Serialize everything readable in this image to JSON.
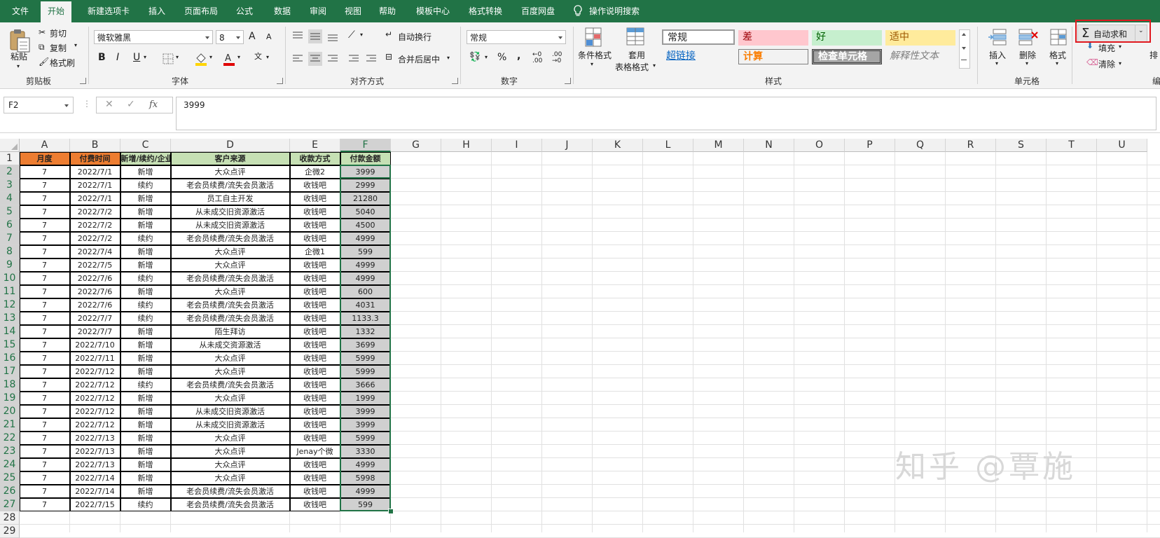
{
  "menu": {
    "tabs": [
      "文件",
      "开始",
      "新建选项卡",
      "插入",
      "页面布局",
      "公式",
      "数据",
      "审阅",
      "视图",
      "帮助",
      "模板中心",
      "格式转换",
      "百度网盘"
    ],
    "active_tab": "开始",
    "tell_me": "操作说明搜索"
  },
  "ribbon": {
    "clipboard": {
      "paste": "粘贴",
      "cut": "剪切",
      "copy": "复制",
      "format_painter": "格式刷",
      "label": "剪贴板"
    },
    "font": {
      "family": "微软雅黑",
      "size": "8",
      "grow": "A",
      "shrink": "A",
      "bold": "B",
      "italic": "I",
      "underline": "U",
      "wen": "文",
      "label": "字体"
    },
    "alignment": {
      "wrap": "自动换行",
      "merge": "合并后居中",
      "label": "对齐方式"
    },
    "number": {
      "format": "常规",
      "percent": "%",
      "comma": ",",
      "label": "数字"
    },
    "styles": {
      "conditional": "条件格式",
      "table_format_1": "套用",
      "table_format_2": "表格格式",
      "cells": [
        "常规",
        "差",
        "好",
        "适中",
        "超链接",
        "计算",
        "检查单元格",
        "解释性文本"
      ],
      "label": "样式"
    },
    "cells": {
      "insert": "插入",
      "delete": "删除",
      "format": "格式",
      "label": "单元格"
    },
    "editing": {
      "autosum": "自动求和",
      "fill": "填充",
      "clear": "清除",
      "sort": "排",
      "label": "编"
    },
    "colors": {
      "bad_bg": "#ffc7ce",
      "bad_fg": "#9c0006",
      "good_bg": "#c6efce",
      "good_fg": "#006100",
      "neutral_bg": "#ffeb9c",
      "neutral_fg": "#9c5700",
      "calc_fg": "#fa7d00",
      "highlight": "#e0191f"
    }
  },
  "formula_bar": {
    "name_box": "F2",
    "fx": "fx",
    "content": "3999"
  },
  "sheet": {
    "columns": [
      "A",
      "B",
      "C",
      "D",
      "E",
      "F",
      "G",
      "H",
      "I",
      "J",
      "K",
      "L",
      "M",
      "N",
      "O",
      "P",
      "Q",
      "R",
      "S",
      "T",
      "U"
    ],
    "selected_col": "F",
    "header": [
      "月度",
      "付费时间",
      "新增/续约/企业",
      "客户来源",
      "收款方式",
      "付款金额"
    ],
    "header_colors": [
      "#ed7d31",
      "#ed7d31",
      "#c6e0b4",
      "#c6e0b4",
      "#c6e0b4",
      "#c6e0b4"
    ],
    "rows": [
      [
        "7",
        "2022/7/1",
        "新增",
        "大众点评",
        "企微2",
        "3999"
      ],
      [
        "7",
        "2022/7/1",
        "续约",
        "老会员续费/流失会员激活",
        "收钱吧",
        "2999"
      ],
      [
        "7",
        "2022/7/1",
        "新增",
        "员工自主开发",
        "收钱吧",
        "21280"
      ],
      [
        "7",
        "2022/7/2",
        "新增",
        "从未成交旧资源激活",
        "收钱吧",
        "5040"
      ],
      [
        "7",
        "2022/7/2",
        "新增",
        "从未成交旧资源激活",
        "收钱吧",
        "4500"
      ],
      [
        "7",
        "2022/7/2",
        "续约",
        "老会员续费/流失会员激活",
        "收钱吧",
        "4999"
      ],
      [
        "7",
        "2022/7/4",
        "新增",
        "大众点评",
        "企微1",
        "599"
      ],
      [
        "7",
        "2022/7/5",
        "新增",
        "大众点评",
        "收钱吧",
        "4999"
      ],
      [
        "7",
        "2022/7/6",
        "续约",
        "老会员续费/流失会员激活",
        "收钱吧",
        "4999"
      ],
      [
        "7",
        "2022/7/6",
        "新增",
        "大众点评",
        "收钱吧",
        "600"
      ],
      [
        "7",
        "2022/7/6",
        "续约",
        "老会员续费/流失会员激活",
        "收钱吧",
        "4031"
      ],
      [
        "7",
        "2022/7/7",
        "续约",
        "老会员续费/流失会员激活",
        "收钱吧",
        "1133.3"
      ],
      [
        "7",
        "2022/7/7",
        "新增",
        "陌生拜访",
        "收钱吧",
        "1332"
      ],
      [
        "7",
        "2022/7/10",
        "新增",
        "从未成交资源激活",
        "收钱吧",
        "3699"
      ],
      [
        "7",
        "2022/7/11",
        "新增",
        "大众点评",
        "收钱吧",
        "5999"
      ],
      [
        "7",
        "2022/7/12",
        "新增",
        "大众点评",
        "收钱吧",
        "5999"
      ],
      [
        "7",
        "2022/7/12",
        "续约",
        "老会员续费/流失会员激活",
        "收钱吧",
        "3666"
      ],
      [
        "7",
        "2022/7/12",
        "新增",
        "大众点评",
        "收钱吧",
        "1999"
      ],
      [
        "7",
        "2022/7/12",
        "新增",
        "从未成交旧资源激活",
        "收钱吧",
        "3999"
      ],
      [
        "7",
        "2022/7/12",
        "新增",
        "从未成交旧资源激活",
        "收钱吧",
        "3999"
      ],
      [
        "7",
        "2022/7/13",
        "新增",
        "大众点评",
        "收钱吧",
        "5999"
      ],
      [
        "7",
        "2022/7/13",
        "新增",
        "大众点评",
        "Jenay个微",
        "3330"
      ],
      [
        "7",
        "2022/7/13",
        "新增",
        "大众点评",
        "收钱吧",
        "4999"
      ],
      [
        "7",
        "2022/7/14",
        "新增",
        "大众点评",
        "收钱吧",
        "5998"
      ],
      [
        "7",
        "2022/7/14",
        "新增",
        "老会员续费/流失会员激活",
        "收钱吧",
        "4999"
      ],
      [
        "7",
        "2022/7/15",
        "续约",
        "老会员续费/流失会员激活",
        "收钱吧",
        "599"
      ]
    ],
    "selection_fill": "#d0d0d0",
    "selection_border": "#217346"
  },
  "watermark": "知乎 @覃施"
}
